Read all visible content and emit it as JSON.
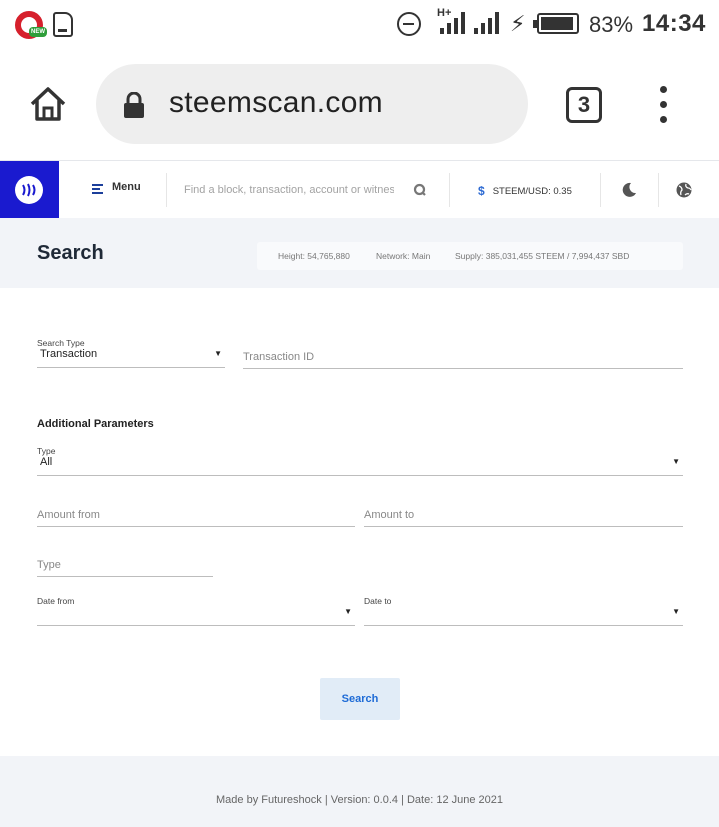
{
  "status_bar": {
    "battery_percent": "83%",
    "battery_level": 0.83,
    "time": "14:34",
    "network_type": "H+",
    "icons": [
      "opera-news-icon",
      "sim-card-icon",
      "do-not-disturb-icon",
      "signal-icon",
      "charging-icon",
      "battery-icon"
    ]
  },
  "browser": {
    "url": "steemscan.com",
    "tab_count": "3",
    "icons": [
      "home-icon",
      "lock-icon",
      "tabs-icon",
      "more-vert-icon"
    ]
  },
  "nav": {
    "menu_label": "Menu",
    "search_placeholder": "Find a block, transaction, account or witness",
    "price": "STEEM/USD: 0.35",
    "brand_color": "#1a1acf",
    "accent_color": "#2e6bd3"
  },
  "header": {
    "title": "Search",
    "height": "Height: 54,765,880",
    "network": "Network: Main",
    "supply": "Supply: 385,031,455 STEEM / 7,994,437 SBD"
  },
  "form": {
    "search_type_label": "Search Type",
    "search_type_value": "Transaction",
    "transaction_id_placeholder": "Transaction ID",
    "additional_params_title": "Additional Parameters",
    "type_label": "Type",
    "type_value": "All",
    "amount_from_placeholder": "Amount from",
    "amount_to_placeholder": "Amount to",
    "type_text_placeholder": "Type",
    "date_from_label": "Date from",
    "date_to_label": "Date to",
    "search_button": "Search"
  },
  "footer": {
    "text": "Made by Futureshock |  Version: 0.0.4 | Date: 12 June 2021"
  }
}
